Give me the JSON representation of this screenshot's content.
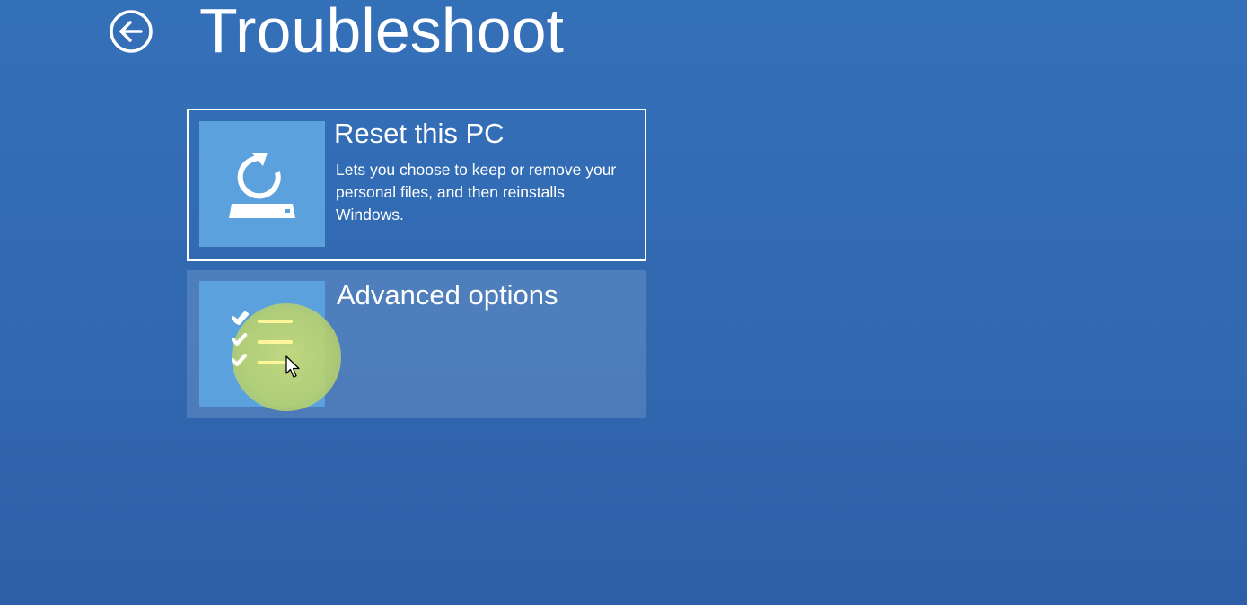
{
  "header": {
    "title": "Troubleshoot",
    "back_icon": "back-arrow-circle-icon"
  },
  "options": [
    {
      "title": "Reset this PC",
      "description": "Lets you choose to keep or remove your personal files, and then reinstalls Windows.",
      "icon": "reset-pc-icon",
      "selected": true
    },
    {
      "title": "Advanced options",
      "description": "",
      "icon": "checklist-icon",
      "hovered": true
    }
  ],
  "colors": {
    "background": "#3470b8",
    "tile_icon_bg": "#5ba1dd",
    "text": "#ffffff",
    "checklist_line": "#fff59a",
    "cursor_highlight": "#c0d778"
  }
}
